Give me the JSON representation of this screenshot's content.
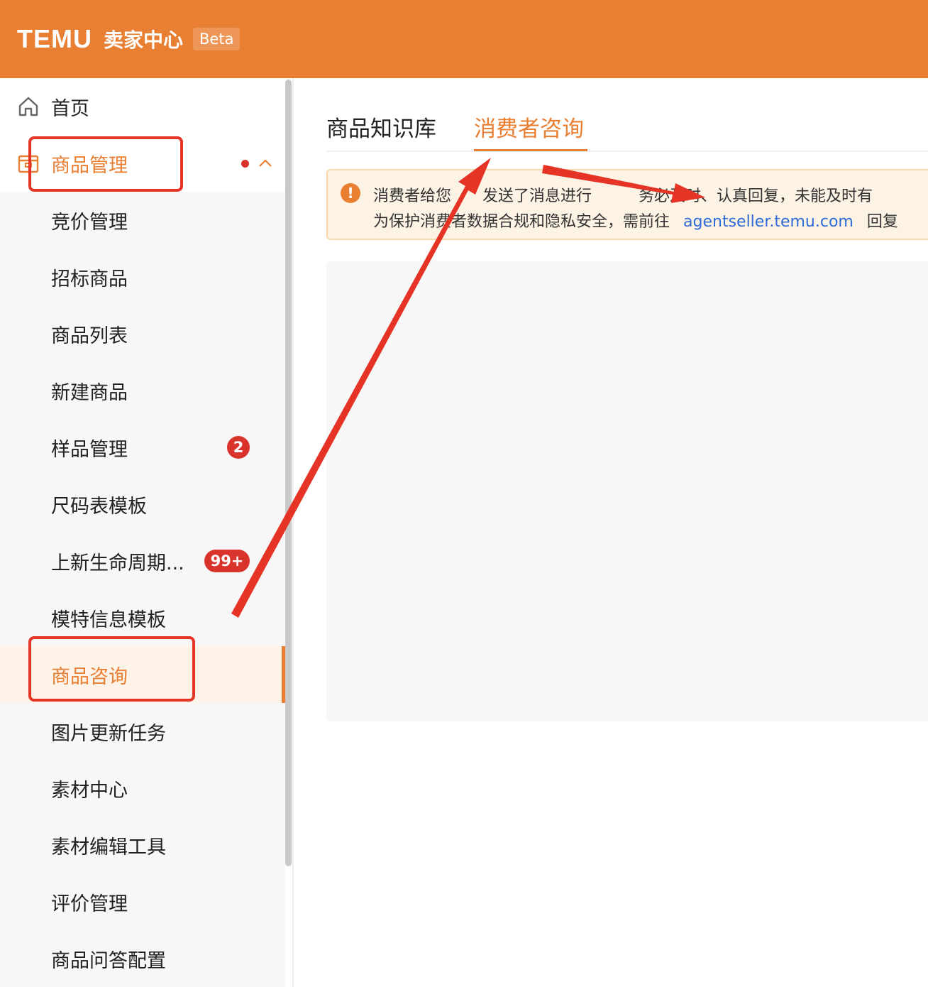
{
  "header": {
    "logo": "TEMU",
    "center_name": "卖家中心",
    "beta": "Beta",
    "bg_color": "#e97f33"
  },
  "sidebar": {
    "home": {
      "label": "首页",
      "icon": "home-icon"
    },
    "product_mgmt": {
      "label": "商品管理",
      "icon": "product-box-icon",
      "expanded": true
    },
    "items": [
      {
        "label": "竞价管理"
      },
      {
        "label": "招标商品"
      },
      {
        "label": "商品列表"
      },
      {
        "label": "新建商品"
      },
      {
        "label": "样品管理",
        "badge": "2"
      },
      {
        "label": "尺码表模板"
      },
      {
        "label": "上新生命周期...",
        "badge": "99+"
      },
      {
        "label": "模特信息模板"
      },
      {
        "label": "商品咨询",
        "active": true
      },
      {
        "label": "图片更新任务"
      },
      {
        "label": "素材中心"
      },
      {
        "label": "素材编辑工具"
      },
      {
        "label": "评价管理"
      },
      {
        "label": "商品问答配置"
      }
    ]
  },
  "tabs": [
    {
      "label": "商品知识库",
      "active": false
    },
    {
      "label": "消费者咨询",
      "active": true
    }
  ],
  "notice": {
    "line1": "消费者给您　　发送了消息进行　　　务必及时、认真回复，未能及时有",
    "line2_prefix": "为保护消费者数据合规和隐私安全，需前往",
    "link": "agentseller.temu.com",
    "line2_suffix": "回复"
  },
  "colors": {
    "accent": "#e97f33",
    "badge": "#d9342b",
    "annotation": "#e53425",
    "link": "#2e6bd9"
  }
}
